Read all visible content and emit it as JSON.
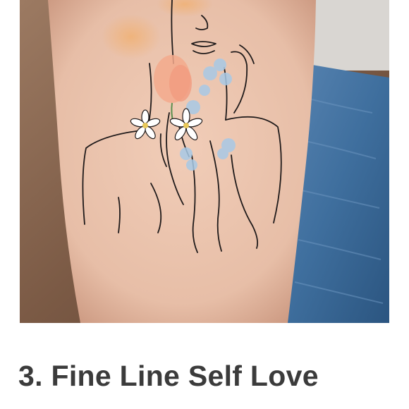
{
  "article": {
    "image": {
      "subject": "fine-line-self-love-tattoo-photo",
      "colors": {
        "skin": "#e7bea7",
        "denim": "#3f6f9e",
        "background_wood": "#7b5a45",
        "ink": "#1f1a1a",
        "blush_orange": "#f0b277",
        "flower_blue": "#a8c9e6"
      }
    },
    "heading": {
      "number": "3.",
      "title": "Fine Line Self Love"
    }
  }
}
